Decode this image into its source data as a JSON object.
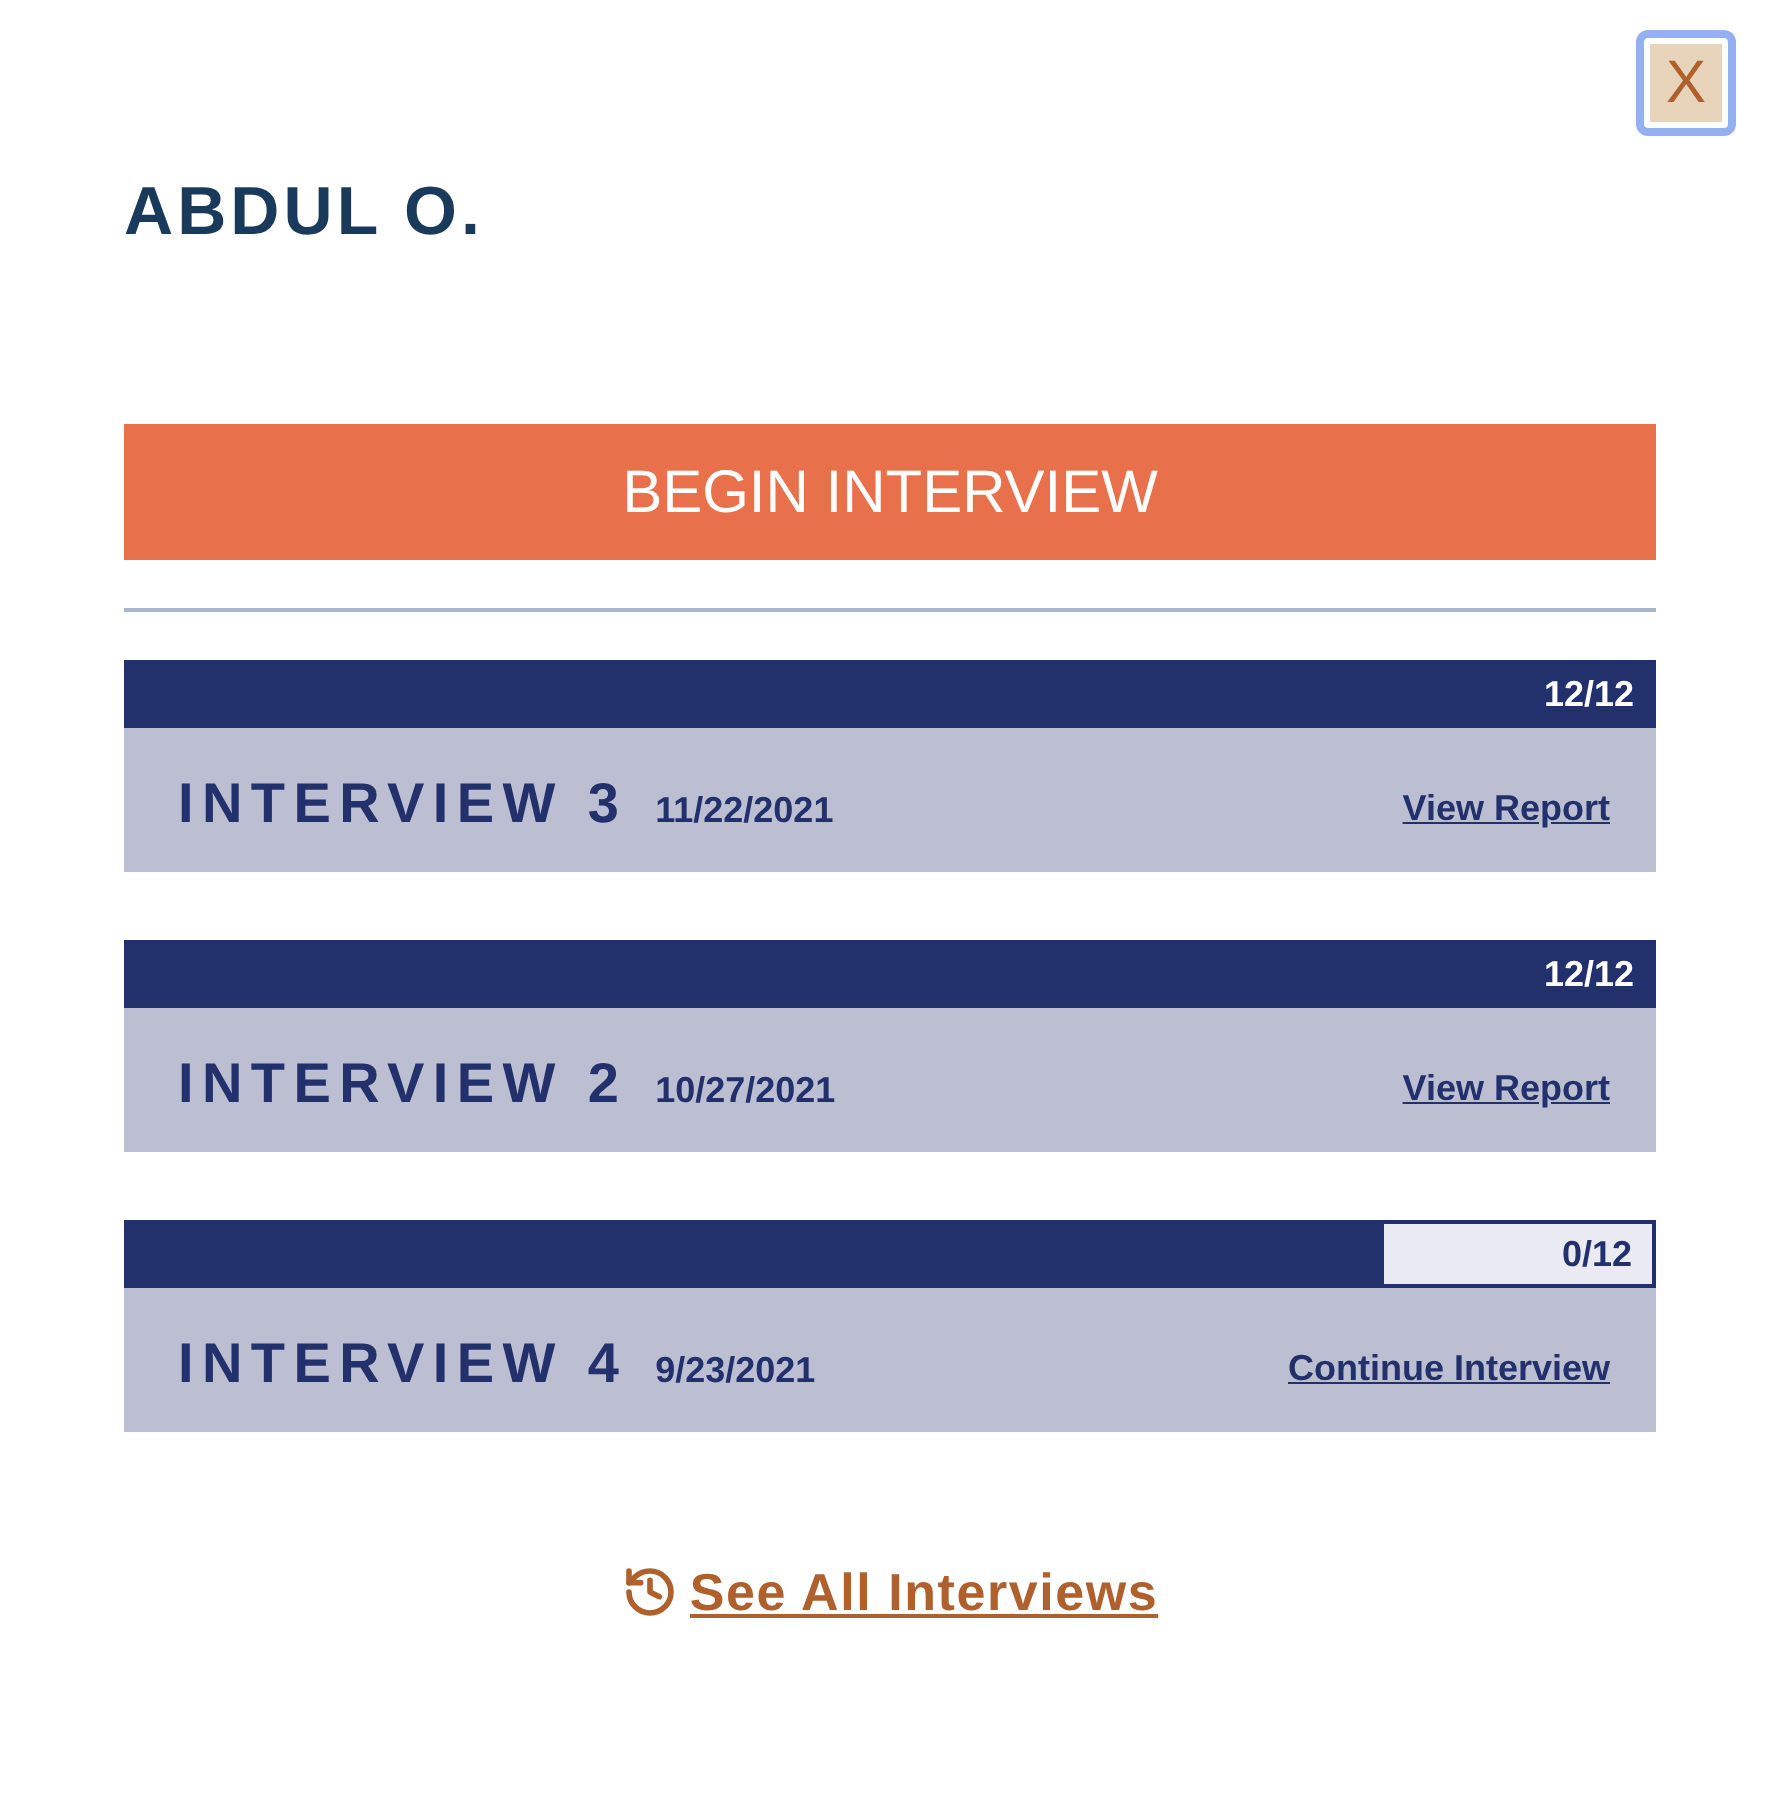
{
  "close_button": {
    "label": "X"
  },
  "candidate": {
    "name": "ABDUL O."
  },
  "begin_button": {
    "label": "BEGIN INTERVIEW"
  },
  "interviews": [
    {
      "title": "INTERVIEW 3",
      "date": "11/22/2021",
      "progress": "12/12",
      "complete": true,
      "action": "View Report"
    },
    {
      "title": "INTERVIEW 2",
      "date": "10/27/2021",
      "progress": "12/12",
      "complete": true,
      "action": "View Report"
    },
    {
      "title": "INTERVIEW 4",
      "date": "9/23/2021",
      "progress": "0/12",
      "complete": false,
      "action": "Continue Interview"
    }
  ],
  "see_all_link": {
    "label": "See All Interviews"
  }
}
